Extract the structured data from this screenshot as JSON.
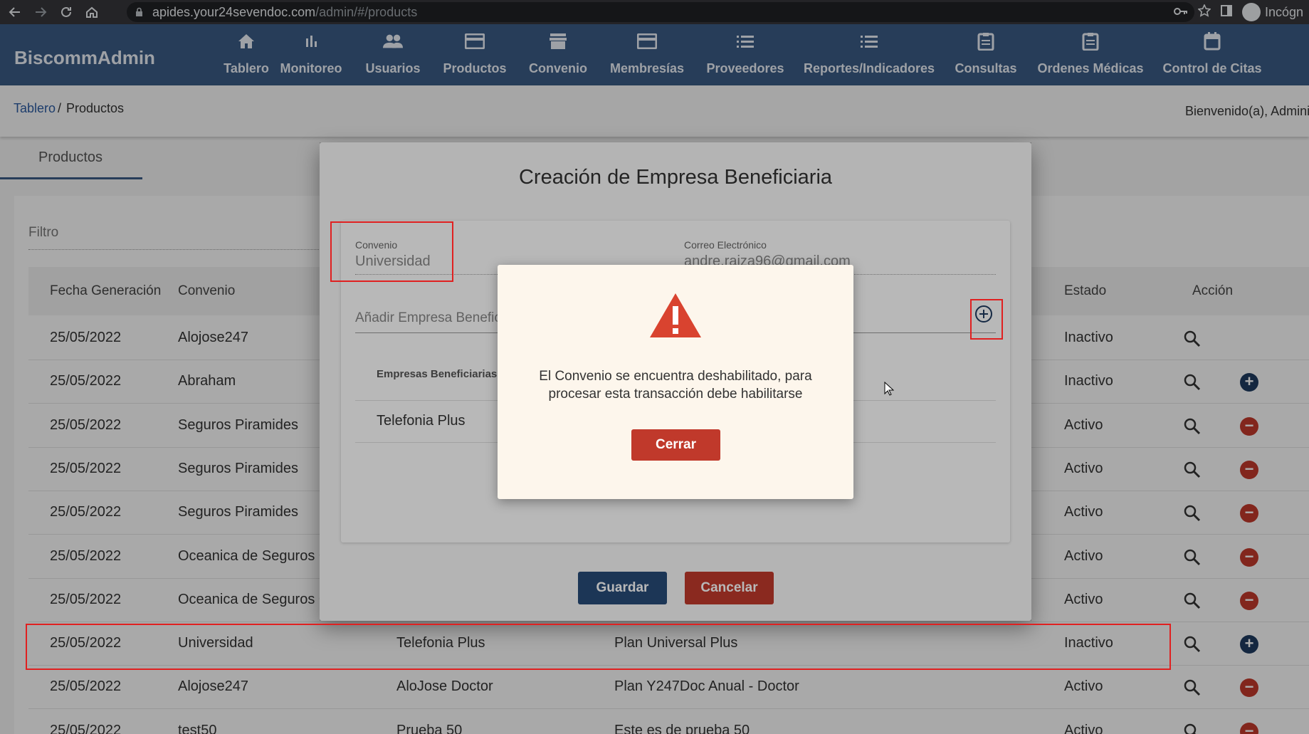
{
  "browser": {
    "url_host": "apides.your24sevendoc.com",
    "url_path": "/admin/#/products",
    "incognito_label": "Incógn"
  },
  "app": {
    "brand": "BiscommAdmin",
    "nav": [
      {
        "label": "Tablero",
        "icon": "home-icon"
      },
      {
        "label": "Monitoreo",
        "icon": "bar-chart-icon"
      },
      {
        "label": "Usuarios",
        "icon": "people-icon"
      },
      {
        "label": "Productos",
        "icon": "card-icon"
      },
      {
        "label": "Convenio",
        "icon": "store-icon"
      },
      {
        "label": "Membresías",
        "icon": "card-icon"
      },
      {
        "label": "Proveedores",
        "icon": "list-icon"
      },
      {
        "label": "Reportes/Indicadores",
        "icon": "list-icon"
      },
      {
        "label": "Consultas",
        "icon": "clipboard-icon"
      },
      {
        "label": "Ordenes Médicas",
        "icon": "clipboard-icon"
      },
      {
        "label": "Control de Citas",
        "icon": "calendar-icon"
      }
    ]
  },
  "breadcrumb": {
    "link": "Tablero",
    "separator": "/",
    "current": "Productos",
    "welcome": "Bienvenido(a), Adminis"
  },
  "tab": {
    "label": "Productos"
  },
  "filter": {
    "label": "Filtro"
  },
  "table": {
    "headers": {
      "fecha": "Fecha Generación",
      "convenio": "Convenio",
      "estado": "Estado",
      "accion": "Acción"
    },
    "rows": [
      {
        "fecha": "25/05/2022",
        "convenio": "Alojose247",
        "empresa": "",
        "plan": "",
        "estado": "Inactivo",
        "action": "none"
      },
      {
        "fecha": "25/05/2022",
        "convenio": "Abraham",
        "empresa": "",
        "plan": "",
        "estado": "Inactivo",
        "action": "add"
      },
      {
        "fecha": "25/05/2022",
        "convenio": "Seguros Piramides",
        "empresa": "",
        "plan": "",
        "estado": "Activo",
        "action": "remove"
      },
      {
        "fecha": "25/05/2022",
        "convenio": "Seguros Piramides",
        "empresa": "",
        "plan": "",
        "estado": "Activo",
        "action": "remove"
      },
      {
        "fecha": "25/05/2022",
        "convenio": "Seguros Piramides",
        "empresa": "",
        "plan": "",
        "estado": "Activo",
        "action": "remove"
      },
      {
        "fecha": "25/05/2022",
        "convenio": "Oceanica de Seguros C",
        "empresa": "",
        "plan": "",
        "estado": "Activo",
        "action": "remove"
      },
      {
        "fecha": "25/05/2022",
        "convenio": "Oceanica de Seguros C",
        "empresa": "",
        "plan": "",
        "estado": "Activo",
        "action": "remove"
      },
      {
        "fecha": "25/05/2022",
        "convenio": "Universidad",
        "empresa": "Telefonia Plus",
        "plan": "Plan Universal Plus",
        "estado": "Inactivo",
        "action": "add"
      },
      {
        "fecha": "25/05/2022",
        "convenio": "Alojose247",
        "empresa": "AloJose Doctor",
        "plan": "Plan Y247Doc Anual - Doctor",
        "estado": "Activo",
        "action": "remove"
      },
      {
        "fecha": "25/05/2022",
        "convenio": "test50",
        "empresa": "Prueba 50",
        "plan": "Este es de prueba 50",
        "estado": "Activo",
        "action": "remove"
      }
    ]
  },
  "dialog": {
    "title": "Creación de Empresa Beneficiaria",
    "convenio_label": "Convenio",
    "convenio_value": "Universidad",
    "email_label": "Correo Electrónico",
    "email_value": "andre.raiza96@gmail.com",
    "add_placeholder": "Añadir Empresa Benefic",
    "list_header": "Empresas Beneficiarias A",
    "list_item": "Telefonia Plus",
    "save_label": "Guardar",
    "cancel_label": "Cancelar"
  },
  "alert": {
    "message_line1": "El Convenio se encuentra deshabilitado, para",
    "message_line2": "procesar esta transacción debe habilitarse",
    "close_label": "Cerrar"
  },
  "colors": {
    "appbar": "#3a5b83",
    "danger": "#c0392b",
    "primary": "#274b78",
    "annotation": "#e02020"
  }
}
